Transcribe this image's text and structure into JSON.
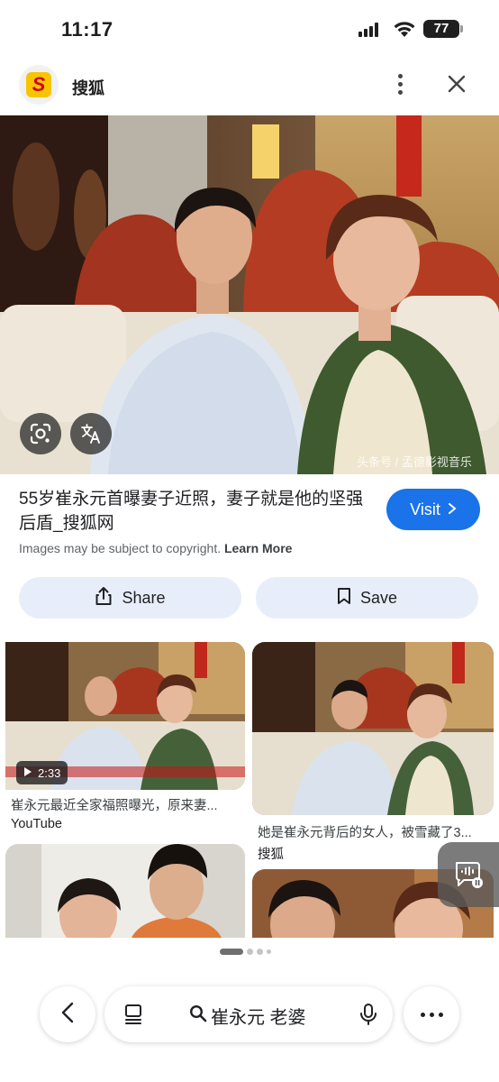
{
  "status_bar": {
    "time": "11:17",
    "battery": "77"
  },
  "header": {
    "site_name": "搜狐",
    "logo_letter": "S"
  },
  "main_image": {
    "alt": "",
    "watermark": "头条号 / 孟德影视音乐",
    "lens_icon": "google-lens-icon",
    "translate_icon": "translate-icon"
  },
  "info": {
    "title": "55岁崔永元首曝妻子近照，妻子就是他的坚强后盾_搜狐网",
    "visit_label": "Visit",
    "copyright_text": "Images may be subject to copyright.",
    "learn_more": "Learn More",
    "share_label": "Share",
    "save_label": "Save"
  },
  "results": [
    {
      "caption": "崔永元最近全家福照曝光，原来妻...",
      "source": "YouTube",
      "duration": "2:33"
    },
    {
      "caption": "她是崔永元背后的女人，被雪藏了3...",
      "source": "搜狐"
    }
  ],
  "search": {
    "query": "崔永元 老婆"
  },
  "colors": {
    "accent": "#1a73e8",
    "chip_bg": "#e8eef9"
  }
}
